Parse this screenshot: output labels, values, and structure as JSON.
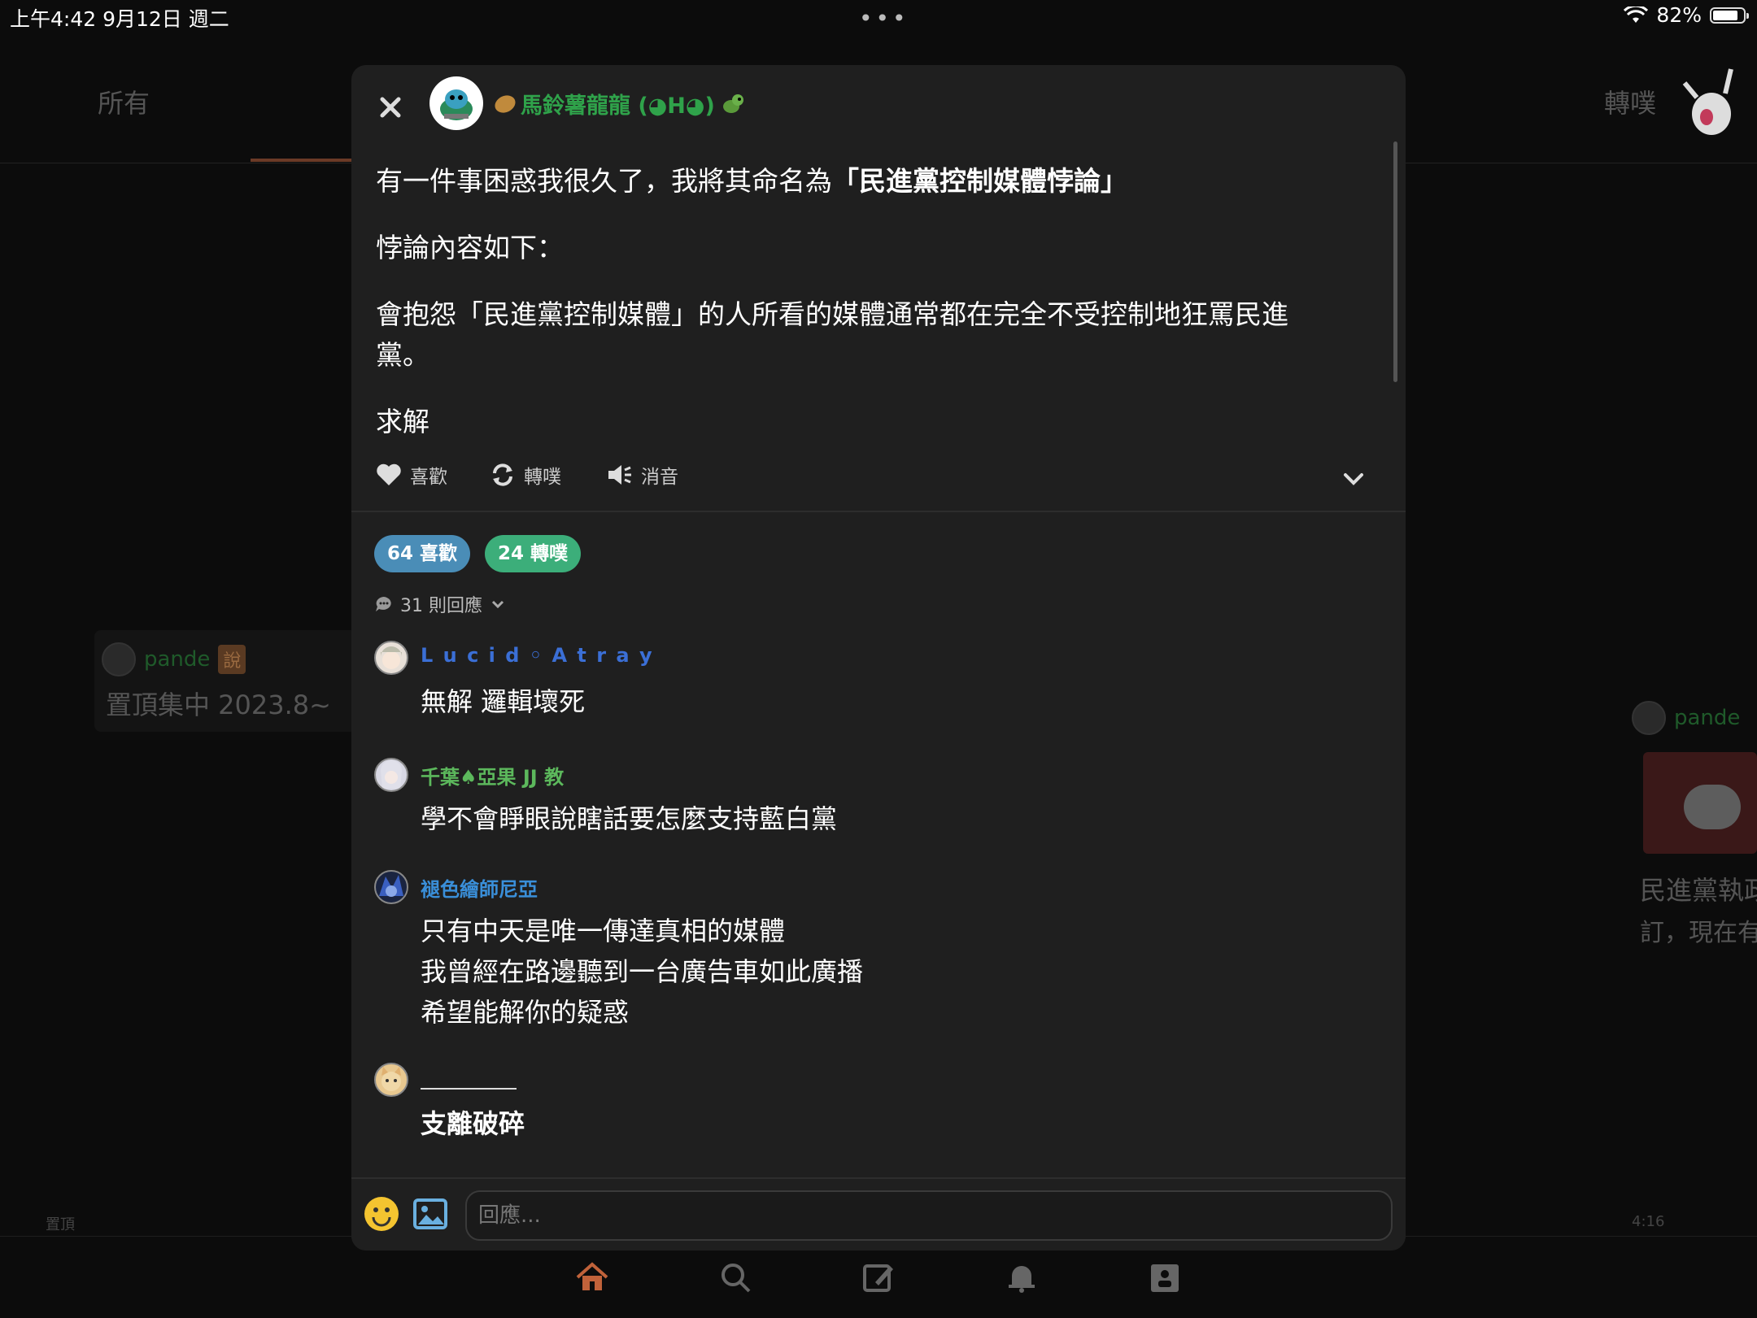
{
  "status_bar": {
    "time": "上午4:42   9月12日 週二",
    "dots": "•••",
    "battery": "82%",
    "battery_level": 0.82
  },
  "background": {
    "tabs": {
      "all": "所有",
      "replurk": "轉噗"
    },
    "card": {
      "user": "pande",
      "badge": "說",
      "text": "置頂集中 2023.8~"
    },
    "pinned_label": "置頂",
    "time_label": "4:16",
    "right_card": {
      "user": "pande",
      "text1": "民進黨執政",
      "text2": "訂，現在有"
    }
  },
  "post": {
    "author": "馬鈴薯龍龍 (◕H◕)",
    "body": {
      "p1_prefix": "有一件事困惑我很久了，我將其命名為",
      "p1_bold": "「民進黨控制媒體悖論」",
      "p2": "悖論內容如下：",
      "p3": "會抱怨「民進黨控制媒體」的人所看的媒體通常都在完全不受控制地狂罵民進黨。",
      "p4": "求解"
    },
    "actions": {
      "like": "喜歡",
      "replurk": "轉噗",
      "mute": "消音"
    },
    "stats": {
      "likes": "64 喜歡",
      "replurks": "24 轉噗"
    },
    "reply_count": "31 則回應"
  },
  "comments": [
    {
      "name": "L u c i d ◦ A t r a y",
      "text": "無解 邏輯壞死",
      "color": "#3b6fd6"
    },
    {
      "name": "千葉♠亞果 JJ 教",
      "text": "學不會睜眼說瞎話要怎麼支持藍白黨",
      "color": "#5cb85c"
    },
    {
      "name": "褪色繪師尼亞",
      "text": "只有中天是唯一傳達真相的媒體\n我曾經在路邊聽到一台廣告車如此廣播\n希望能解你的疑惑",
      "color": "#3a8fd9"
    },
    {
      "name": "",
      "text": "支離破碎",
      "color": "#fff"
    }
  ],
  "reply_input": {
    "placeholder": "回應..."
  },
  "colors": {
    "likes_pill": "#4a8db7",
    "replurks_pill": "#3cae7a",
    "author": "#2fa24a",
    "nav_active": "#c0623a"
  },
  "icons": [
    "close-icon",
    "heart-icon",
    "replurk-icon",
    "mute-icon",
    "chevron-down-icon",
    "speech-bubble-icon",
    "emoji-icon",
    "image-icon",
    "home-icon",
    "search-icon",
    "compose-icon",
    "bell-icon",
    "profile-icon",
    "wifi-icon",
    "battery-icon"
  ]
}
